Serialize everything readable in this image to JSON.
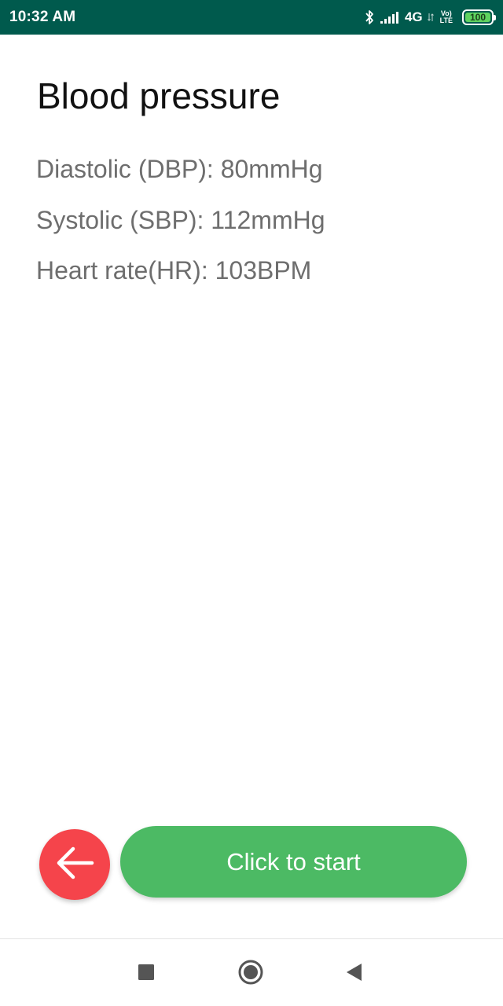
{
  "status_bar": {
    "time": "10:32 AM",
    "network": "4G",
    "volte_top": "Vo)",
    "volte_bottom": "LTE",
    "battery": "100",
    "icons": [
      "bluetooth-icon",
      "signal-icon",
      "battery-icon"
    ],
    "background_color": "#005a4d"
  },
  "page": {
    "title": "Blood pressure",
    "readings": {
      "dbp": "Diastolic (DBP): 80mmHg",
      "sbp": "Systolic (SBP): 112mmHg",
      "hr": "Heart rate(HR): 103BPM"
    }
  },
  "actions": {
    "back_icon": "arrow-left-icon",
    "back_color": "#f5444b",
    "start_label": "Click to start",
    "start_color": "#4cba64"
  },
  "nav_bar": {
    "icons": [
      "recents-icon",
      "home-icon",
      "back-icon"
    ]
  }
}
